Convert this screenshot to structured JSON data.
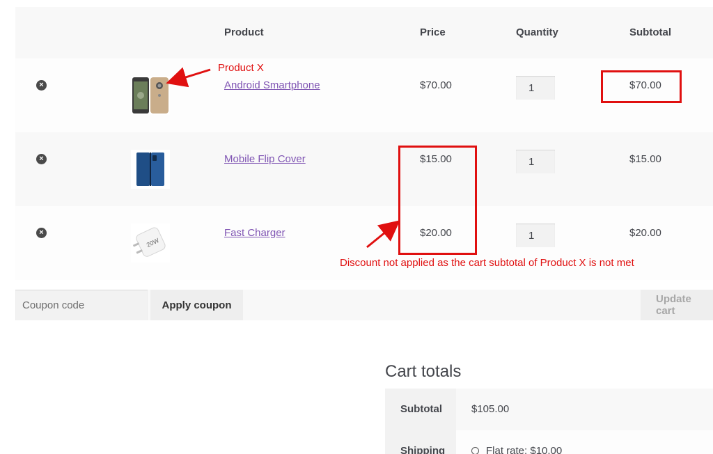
{
  "table": {
    "headers": {
      "product": "Product",
      "price": "Price",
      "quantity": "Quantity",
      "subtotal": "Subtotal"
    },
    "rows": [
      {
        "remove_icon": "remove-circle-x-icon",
        "product": "Android Smartphone",
        "price": "$70.00",
        "quantity": "1",
        "subtotal": "$70.00",
        "thumb_icon": "smartphone-icon"
      },
      {
        "remove_icon": "remove-circle-x-icon",
        "product": "Mobile Flip Cover",
        "price": "$15.00",
        "quantity": "1",
        "subtotal": "$15.00",
        "thumb_icon": "flip-cover-icon"
      },
      {
        "remove_icon": "remove-circle-x-icon",
        "product": "Fast Charger",
        "price": "$20.00",
        "quantity": "1",
        "subtotal": "$20.00",
        "thumb_icon": "charger-icon"
      }
    ]
  },
  "actions": {
    "coupon_placeholder": "Coupon code",
    "apply_label": "Apply coupon",
    "update_label": "Update cart"
  },
  "totals": {
    "title": "Cart totals",
    "subtotal_label": "Subtotal",
    "subtotal_value": "$105.00",
    "shipping_label": "Shipping",
    "shipping_value": "Flat rate: $10.00"
  },
  "annotations": {
    "product_x": "Product X",
    "discount_note": "Discount not applied as the cart subtotal of Product X is not met",
    "color": "#e01010"
  },
  "colors": {
    "link": "#7f54b3",
    "text": "#43454b"
  }
}
